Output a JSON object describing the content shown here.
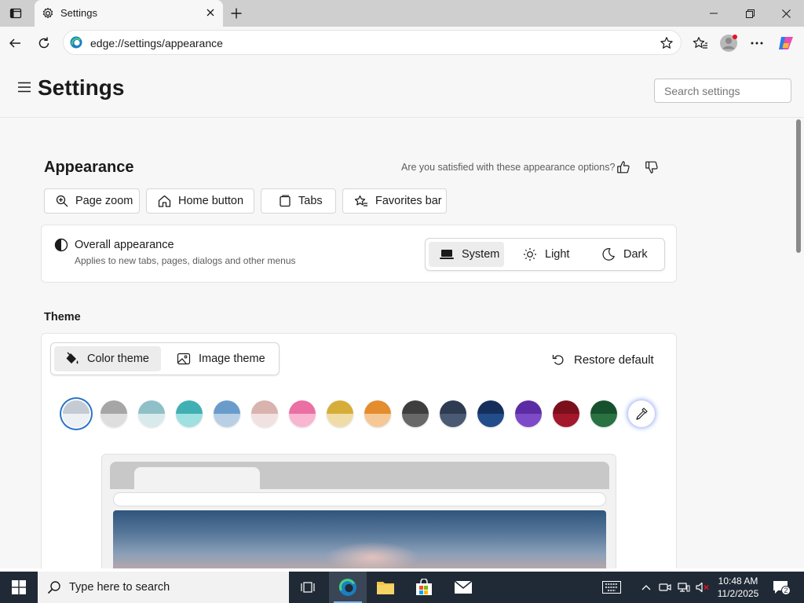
{
  "browser": {
    "tab_title": "Settings",
    "url": "edge://settings/appearance"
  },
  "settings": {
    "title": "Settings",
    "search_placeholder": "Search settings"
  },
  "appearance": {
    "heading": "Appearance",
    "satisfaction_prompt": "Are you satisfied with these appearance options?",
    "quick_links": [
      {
        "label": "Page zoom",
        "icon": "zoom-icon"
      },
      {
        "label": "Home button",
        "icon": "home-icon"
      },
      {
        "label": "Tabs",
        "icon": "tabs-icon"
      },
      {
        "label": "Favorites bar",
        "icon": "favorites-icon"
      }
    ],
    "overall": {
      "title": "Overall appearance",
      "subtitle": "Applies to new tabs, pages, dialogs and other menus",
      "options": [
        "System",
        "Light",
        "Dark"
      ],
      "selected": "System"
    }
  },
  "theme": {
    "heading": "Theme",
    "tabs": [
      "Color theme",
      "Image theme"
    ],
    "selected_tab": "Color theme",
    "restore_label": "Restore default",
    "swatches": [
      {
        "top": "#c4cbd3",
        "bottom": "#eef1f4",
        "selected": true
      },
      {
        "top": "#a6a6a6",
        "bottom": "#dedede"
      },
      {
        "top": "#8fc0c8",
        "bottom": "#d8eaec"
      },
      {
        "top": "#40b0b4",
        "bottom": "#9fe0e0"
      },
      {
        "top": "#6a9ccb",
        "bottom": "#b8cfe6"
      },
      {
        "top": "#d9b3ad",
        "bottom": "#f2e1e1"
      },
      {
        "top": "#ea6fa3",
        "bottom": "#f8b6d1"
      },
      {
        "top": "#d7ad3a",
        "bottom": "#f0dca6"
      },
      {
        "top": "#e48d2f",
        "bottom": "#f6c896"
      },
      {
        "top": "#3e3e3e",
        "bottom": "#686868"
      },
      {
        "top": "#2e3b50",
        "bottom": "#4a5a72"
      },
      {
        "top": "#152f5c",
        "bottom": "#234c8a"
      },
      {
        "top": "#5c2ca4",
        "bottom": "#7d4ac8"
      },
      {
        "top": "#7c0f1c",
        "bottom": "#a3192b"
      },
      {
        "top": "#17502c",
        "bottom": "#2a7242"
      }
    ]
  },
  "taskbar": {
    "search_placeholder": "Type here to search",
    "time": "10:48 AM",
    "date": "11/2/2025",
    "notification_count": "2"
  }
}
